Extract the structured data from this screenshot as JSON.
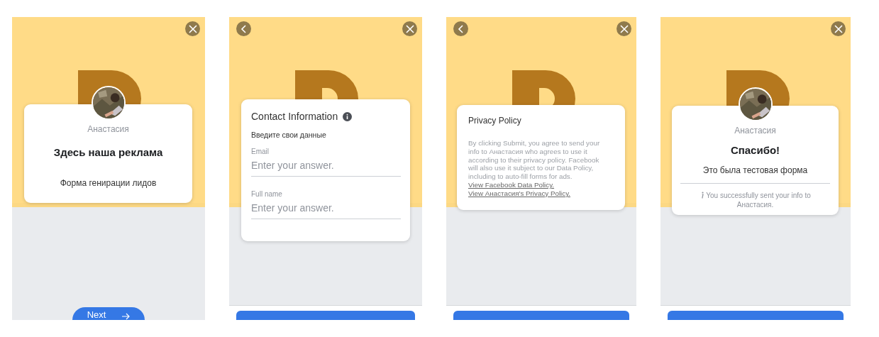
{
  "screens": [
    {
      "kind": "intro",
      "has_back": false,
      "page_name": "Анастасия",
      "title": "Здесь наша реклама",
      "subtitle": "Форма генирации лидов",
      "button_label": "Next"
    },
    {
      "kind": "form",
      "has_back": true,
      "title": "Contact Information",
      "subtitle": "Введите свои данные",
      "fields": [
        {
          "label": "Email",
          "placeholder": "Enter your answer."
        },
        {
          "label": "Full name",
          "placeholder": "Enter your answer."
        }
      ]
    },
    {
      "kind": "privacy",
      "has_back": true,
      "title": "Privacy Policy",
      "body": "By clicking Submit, you agree to send your info to Анастасия who agrees to use it according to their privacy policy. Facebook will also use it subject to our Data Policy, including to auto-fill forms for ads.",
      "links": [
        "View Facebook Data Policy.",
        "View Анастасия's Privacy Policy."
      ]
    },
    {
      "kind": "thanks",
      "has_back": false,
      "page_name": "Анастасия",
      "title": "Спасибо!",
      "subtitle": "Это была тестовая форма",
      "note": "You successfully sent your info to Анастасия."
    }
  ]
}
